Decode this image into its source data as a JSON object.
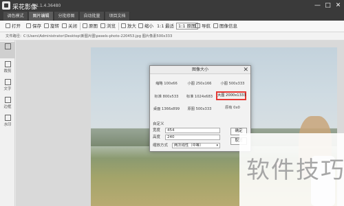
{
  "app": {
    "title": "采花影像",
    "version": "V1.1.4.36480"
  },
  "window_controls": [
    "—",
    "□",
    "✕"
  ],
  "tabs": [
    "调色模式",
    "图片编辑",
    "分批修图",
    "自动批量",
    "项目文档"
  ],
  "active_tab": 1,
  "toolbar": {
    "open": "打开",
    "save": "保存",
    "rotate": "旋转",
    "close": "关闭",
    "original": "原图",
    "browse": "浏览",
    "zoom_in": "放大",
    "zoom_out": "缩小",
    "ratio": "1:1",
    "fit": "最适",
    "original_size": "1:1 原图",
    "nav": "导航",
    "info": "图像信息"
  },
  "pathbar": "文件路径：C:\\Users\\Administrator\\Desktop\\新图片图\\pexels-photo-220453.jpg   图片像素500x333",
  "sidebar": [
    "",
    "裁剪",
    "文字",
    "边框",
    "水印"
  ],
  "dialog": {
    "title": "图像大小",
    "close": "✕",
    "presets": [
      {
        "label": "缩略 100x66"
      },
      {
        "label": "小图 250x166"
      },
      {
        "label": "小图 500x333"
      },
      {
        "label": "标准 800x533"
      },
      {
        "label": "标准 1024x683"
      },
      {
        "label": "大图 2000x1333"
      },
      {
        "label": "桌面 1366x899"
      },
      {
        "label": "原图 500x333"
      },
      {
        "label": "原有 0x0"
      }
    ],
    "highlighted_preset": "大图 2000x1333",
    "custom_section": "自定义",
    "width_label": "宽度",
    "width_value": "454",
    "height_label": "高度",
    "height_value": "240",
    "scale_label": "缩放方式",
    "scale_value": "两次线性（中等）",
    "ok": "确定",
    "cancel": "取消"
  },
  "watermark": "软件技巧",
  "colors": {
    "highlight": "#e53935",
    "titlebar": "#3a3a3a"
  }
}
